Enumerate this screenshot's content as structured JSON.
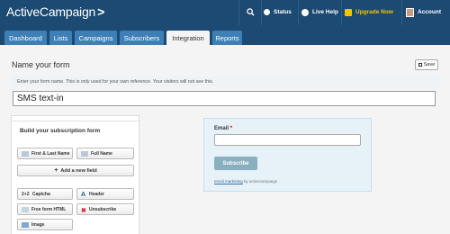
{
  "app": {
    "logo": "ActiveCampaign",
    "logo_chevron": ">"
  },
  "topnav": {
    "status": "Status",
    "live_help": "Live Help",
    "upgrade": "Upgrade Now",
    "account": "Account"
  },
  "tabs": [
    {
      "label": "Dashboard"
    },
    {
      "label": "Lists"
    },
    {
      "label": "Campaigns"
    },
    {
      "label": "Subscribers"
    },
    {
      "label": "Integration",
      "active": true
    },
    {
      "label": "Reports"
    }
  ],
  "page": {
    "title": "Name your form",
    "save_label": "Save",
    "hint": "Enter your form name. This is only used for your own reference. Your visitors will not see this.",
    "form_name_value": "SMS text-in"
  },
  "builder": {
    "title": "Build your subscription form",
    "buttons": {
      "first_last_name": "First & Last Name",
      "full_name": "Full Name",
      "add_field": "Add a new field",
      "captcha": "Captcha",
      "header": "Header",
      "free_form_html": "Free form HTML",
      "unsubscribe": "Unsubscribe",
      "image": "Image"
    }
  },
  "preview": {
    "email_label": "Email",
    "required_mark": "*",
    "subscribe_label": "Subscribe",
    "credit_link": "email marketing",
    "credit_rest": " by activecampaign"
  },
  "colors": {
    "topbar": "#1c4a72",
    "tab": "#3e7fb5",
    "upgrade": "#f5c400",
    "subscribe": "#8aafbf",
    "preview_bg": "#e6f1f8"
  }
}
